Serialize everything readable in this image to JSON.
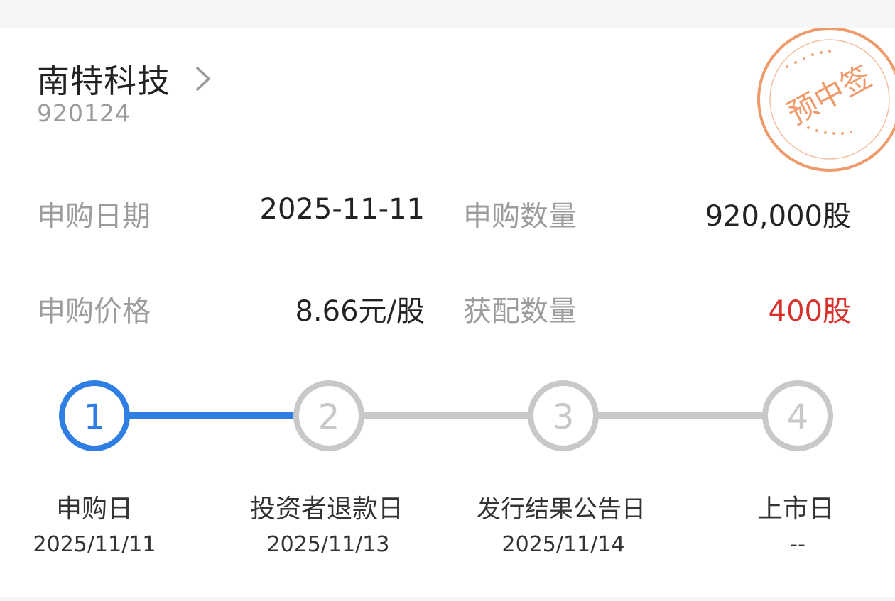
{
  "stock": {
    "name": "南特科技",
    "code": "920124",
    "stamp_text": "预中签"
  },
  "details": {
    "subscribe_date_label": "申购日期",
    "subscribe_date_value": "2025-11-11",
    "subscribe_qty_label": "申购数量",
    "subscribe_qty_value": "920,000股",
    "subscribe_price_label": "申购价格",
    "subscribe_price_value": "8.66元/股",
    "allotted_qty_label": "获配数量",
    "allotted_qty_value": "400股"
  },
  "steps": [
    {
      "num": "1",
      "label": "申购日",
      "date": "2025/11/11",
      "active": true
    },
    {
      "num": "2",
      "label": "投资者退款日",
      "date": "2025/11/13",
      "active": false
    },
    {
      "num": "3",
      "label": "发行结果公告日",
      "date": "2025/11/14",
      "active": false
    },
    {
      "num": "4",
      "label": "上市日",
      "date": "--",
      "active": false
    }
  ],
  "colors": {
    "active": "#2f7ee3",
    "inactive": "#c8c8c8",
    "highlight": "#d9302c",
    "stamp": "#ef9a6b"
  }
}
